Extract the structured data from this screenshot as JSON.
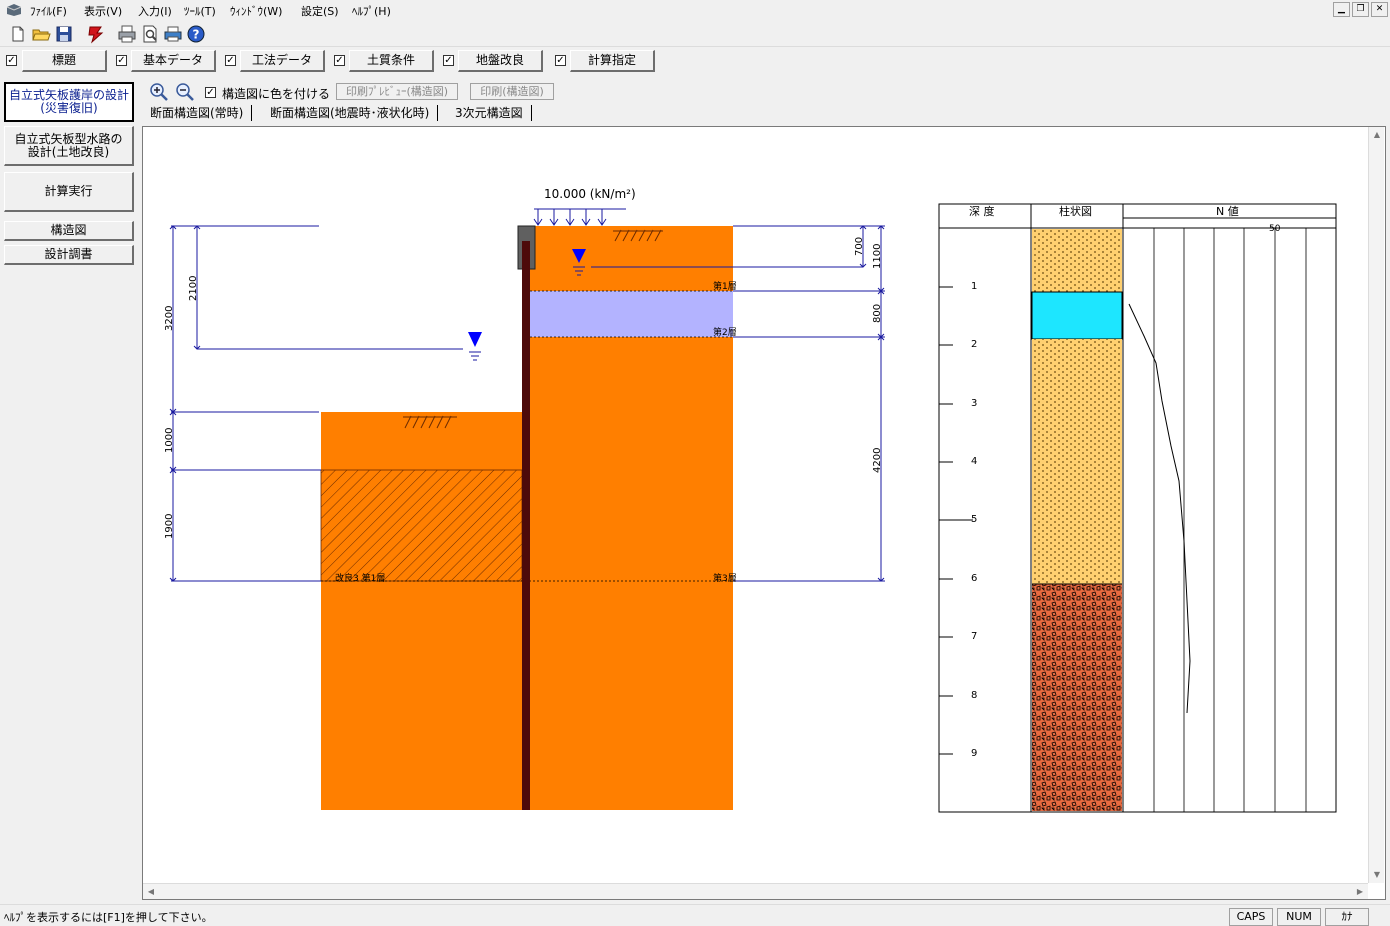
{
  "menu": {
    "items": [
      {
        "label": "ﾌｧｲﾙ(F)"
      },
      {
        "label": "表示(V)"
      },
      {
        "label": "入力(I)"
      },
      {
        "label": "ﾂｰﾙ(T)"
      },
      {
        "label": "ｳｨﾝﾄﾞｳ(W)"
      },
      {
        "label": "設定(S)"
      },
      {
        "label": "ﾍﾙﾌﾟ(H)"
      }
    ],
    "window_controls": [
      "minimize",
      "restore",
      "close"
    ]
  },
  "toolbar": {
    "icons": [
      "new-file-icon",
      "open-folder-icon",
      "save-icon",
      "run-red-icon",
      "print-icon",
      "print-preview-icon",
      "printer-setup-icon",
      "help-icon"
    ]
  },
  "tabs": [
    {
      "label": "標題",
      "checked": true
    },
    {
      "label": "基本データ",
      "checked": true
    },
    {
      "label": "工法データ",
      "checked": true
    },
    {
      "label": "土質条件",
      "checked": true
    },
    {
      "label": "地盤改良",
      "checked": true
    },
    {
      "label": "計算指定",
      "checked": true
    }
  ],
  "sidebar": {
    "items": [
      {
        "label": "自立式矢板護岸の設計\n(災害復旧)",
        "active": true
      },
      {
        "label": "自立式矢板型水路の\n設計(土地改良)",
        "active": false
      },
      {
        "label": "計算実行",
        "active": false
      },
      {
        "label": "構造図",
        "active": false
      },
      {
        "label": "設計調書",
        "active": false
      }
    ]
  },
  "subtoolbar": {
    "zoom_in": "zoom-in-icon",
    "zoom_out": "zoom-out-icon",
    "color_checkbox_label": "構造図に色を付ける",
    "color_checked": true,
    "print_preview_label": "印刷ﾌﾟﾚﾋﾞｭｰ(構造図)",
    "print_label": "印刷(構造図)"
  },
  "view_tabs": [
    {
      "label": "断面構造図(常時)",
      "active": true
    },
    {
      "label": "断面構造図(地震時･液状化時)",
      "active": false
    },
    {
      "label": "3次元構造図",
      "active": false
    }
  ],
  "section_drawing": {
    "load_label": "10.000 (kN/m²)",
    "dims_left": [
      "2100",
      "3200",
      "1000",
      "1900"
    ],
    "dims_right": [
      "700",
      "1100",
      "800",
      "4200"
    ],
    "layer_labels": [
      "第1層",
      "第2層",
      "第3層"
    ],
    "improved_label": "改良3 第1層",
    "colors": {
      "soil": "#ff7f00",
      "layer2": "#b3b3ff",
      "pile": "#4d0a0a",
      "dim": "#1a1aa0",
      "water": "#0000ff"
    }
  },
  "boring_log": {
    "headers": [
      "深 度",
      "柱状図",
      "N 値"
    ],
    "n_scale_label": "50",
    "depth_labels": [
      "1",
      "2",
      "3",
      "4",
      "5",
      "6",
      "7",
      "8",
      "9"
    ],
    "colors": {
      "sand": "#ffd070",
      "water_layer": "#1de6ff",
      "gravel": "#e86a40"
    }
  },
  "statusbar": {
    "message": "ﾍﾙﾌﾟを表示するには[F1]を押して下さい。",
    "indicators": [
      "CAPS",
      "NUM",
      "ｶﾅ"
    ]
  }
}
